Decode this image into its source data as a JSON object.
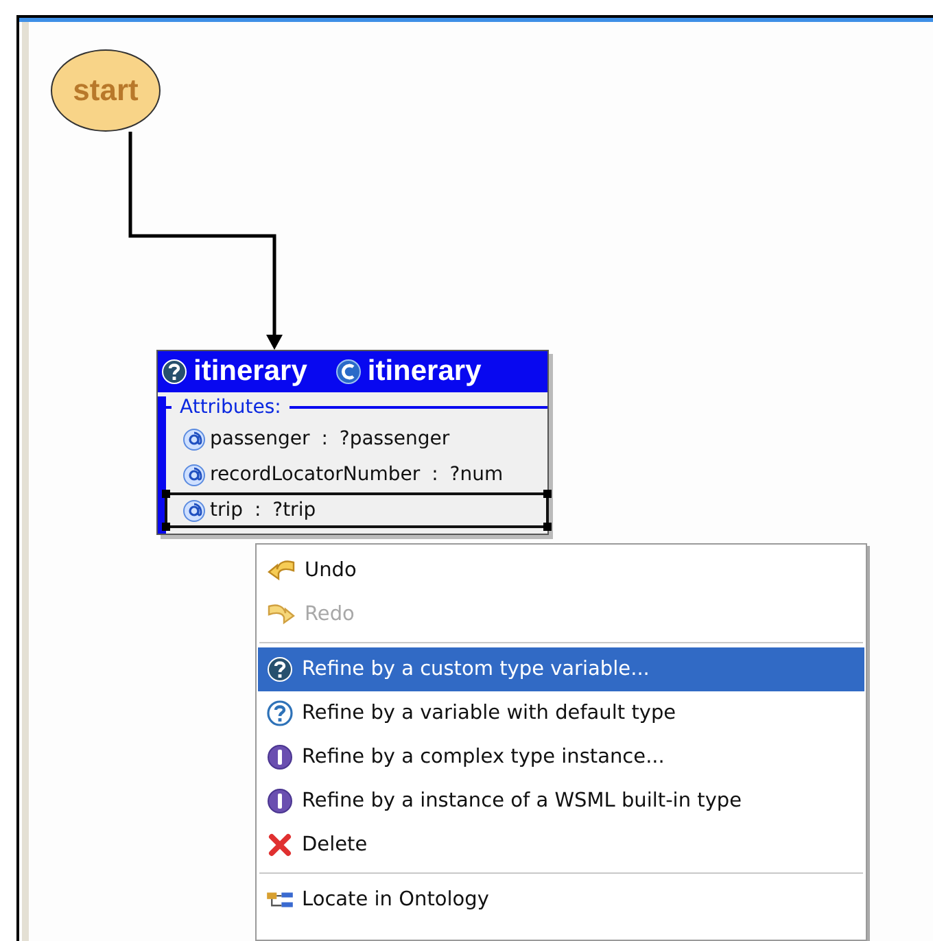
{
  "diagram": {
    "start_node": {
      "label": "start"
    },
    "node": {
      "variable": "itinerary",
      "concept": "itinerary",
      "section_title": "Attributes:",
      "attributes": [
        {
          "text": "passenger : ?passenger",
          "selected": false
        },
        {
          "text": "recordLocatorNumber : ?num",
          "selected": false
        },
        {
          "text": "trip : ?trip",
          "selected": true
        }
      ]
    }
  },
  "context_menu": {
    "items": [
      {
        "kind": "undo",
        "label": "Undo",
        "disabled": false,
        "selected": false
      },
      {
        "kind": "redo",
        "label": "Redo",
        "disabled": true,
        "selected": false
      },
      {
        "kind": "separator"
      },
      {
        "kind": "variable",
        "label": "Refine by a custom type variable...",
        "disabled": false,
        "selected": true
      },
      {
        "kind": "default",
        "label": "Refine by a variable with default type",
        "disabled": false,
        "selected": false
      },
      {
        "kind": "instance",
        "label": "Refine by a complex type instance...",
        "disabled": false,
        "selected": false
      },
      {
        "kind": "instance",
        "label": "Refine by a instance of a WSML built-in type",
        "disabled": false,
        "selected": false
      },
      {
        "kind": "delete",
        "label": "Delete",
        "disabled": false,
        "selected": false
      },
      {
        "kind": "separator"
      },
      {
        "kind": "locate",
        "label": "Locate in Ontology",
        "disabled": false,
        "selected": false
      }
    ]
  }
}
